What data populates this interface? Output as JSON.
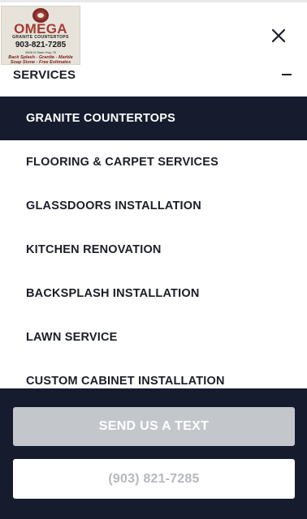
{
  "logo": {
    "name": "OMEGA",
    "subtitle": "GRANITE COUNTERTOPS",
    "phone": "903-821-7285",
    "address": "5506 N State Hwy 78",
    "tagline_1": "Back Splash - Granite - Marble",
    "tagline_2": "Soap Stone - Free Estimates"
  },
  "icons": {
    "close": "close-icon",
    "collapse": "minus-icon"
  },
  "services": {
    "title": "SERVICES",
    "items": [
      {
        "label": "GRANITE COUNTERTOPS",
        "active": true
      },
      {
        "label": "FLOORING & CARPET SERVICES",
        "active": false
      },
      {
        "label": "GLASSDOORS INSTALLATION",
        "active": false
      },
      {
        "label": "KITCHEN RENOVATION",
        "active": false
      },
      {
        "label": "BACKSPLASH INSTALLATION",
        "active": false
      },
      {
        "label": "LAWN SERVICE",
        "active": false
      },
      {
        "label": "CUSTOM CABINET INSTALLATION",
        "active": false
      }
    ]
  },
  "cta": {
    "text_button": "SEND US A TEXT",
    "phone_button": "(903) 821-7285"
  },
  "colors": {
    "navy": "#161c2e",
    "accent_red": "#a53a34",
    "disabled_gray": "#c3c6cb"
  }
}
